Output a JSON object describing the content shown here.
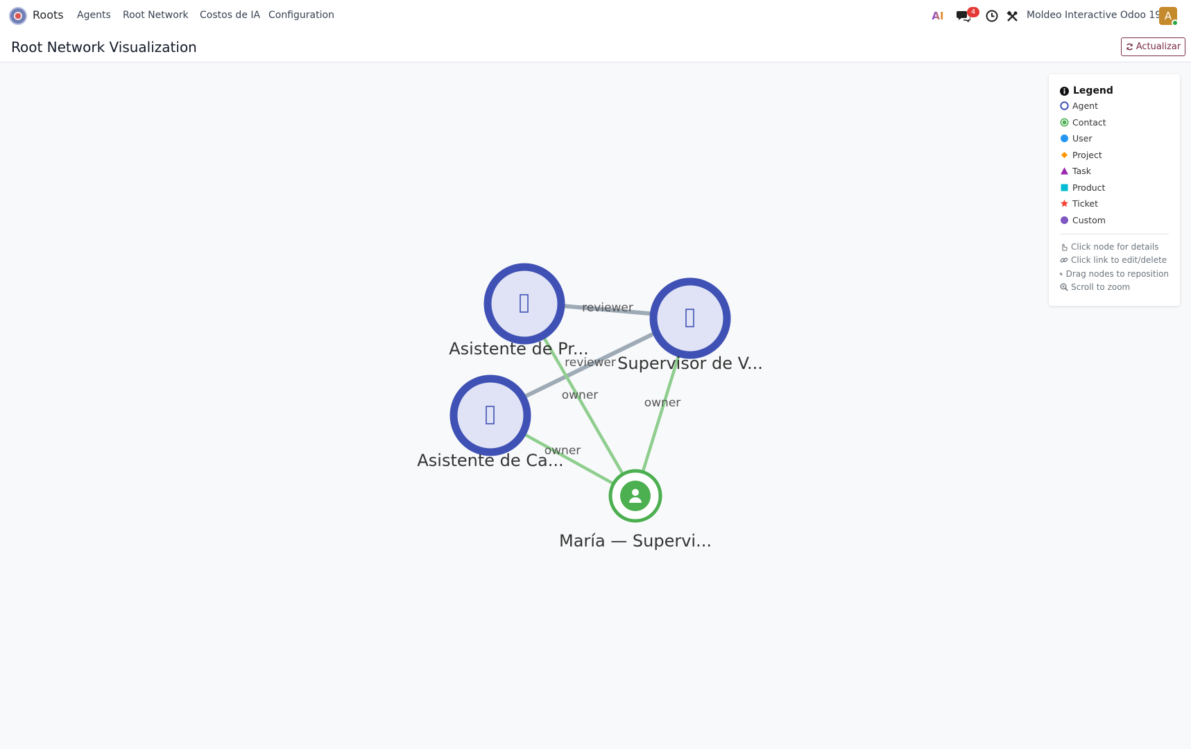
{
  "navbar": {
    "app_name": "Roots",
    "menu": [
      "Agents",
      "Root Network",
      "Costos de IA",
      "Configuration"
    ],
    "ai_label": "AI",
    "messages_count": "4",
    "company": "Moldeo Interactive Odoo 19",
    "avatar_initial": "A"
  },
  "control_panel": {
    "title": "Root Network Visualization",
    "refresh_label": "Actualizar"
  },
  "graph": {
    "nodes": [
      {
        "id": "n1",
        "label": "Asistente de Pr...",
        "type": "agent"
      },
      {
        "id": "n2",
        "label": "Supervisor de V...",
        "type": "agent"
      },
      {
        "id": "n3",
        "label": "Asistente de Ca...",
        "type": "agent"
      },
      {
        "id": "n4",
        "label": "María — Supervi...",
        "type": "contact"
      }
    ],
    "links": [
      {
        "source": "n1",
        "target": "n2",
        "label": "reviewer",
        "kind": "agent"
      },
      {
        "source": "n3",
        "target": "n2",
        "label": "reviewer",
        "kind": "agent"
      },
      {
        "source": "n1",
        "target": "n4",
        "label": "owner",
        "kind": "contact"
      },
      {
        "source": "n2",
        "target": "n4",
        "label": "owner",
        "kind": "contact"
      },
      {
        "source": "n3",
        "target": "n4",
        "label": "owner",
        "kind": "contact"
      }
    ],
    "colors": {
      "agent": "#3f51b5",
      "agent_fill": "#e0e3f5",
      "contact": "#4caf50",
      "agent_link": "#9eabb7",
      "contact_link": "#8fce8f"
    }
  },
  "legend": {
    "title": "Legend",
    "items": [
      {
        "label": "Agent",
        "icon": "agent-ring-icon",
        "color": "#3f51b5"
      },
      {
        "label": "Contact",
        "icon": "contact-ring-icon",
        "color": "#4caf50"
      },
      {
        "label": "User",
        "icon": "user-dot-icon",
        "color": "#2196f3"
      },
      {
        "label": "Project",
        "icon": "diamond-icon",
        "color": "#ff9800"
      },
      {
        "label": "Task",
        "icon": "triangle-icon",
        "color": "#9c27b0"
      },
      {
        "label": "Product",
        "icon": "square-icon",
        "color": "#00bcd4"
      },
      {
        "label": "Ticket",
        "icon": "star-icon",
        "color": "#f44336"
      },
      {
        "label": "Custom",
        "icon": "custom-dot-icon",
        "color": "#7e57c2"
      }
    ],
    "hints": [
      "Click node for details",
      "Click link to edit/delete",
      "Drag nodes to reposition",
      "Scroll to zoom"
    ]
  }
}
